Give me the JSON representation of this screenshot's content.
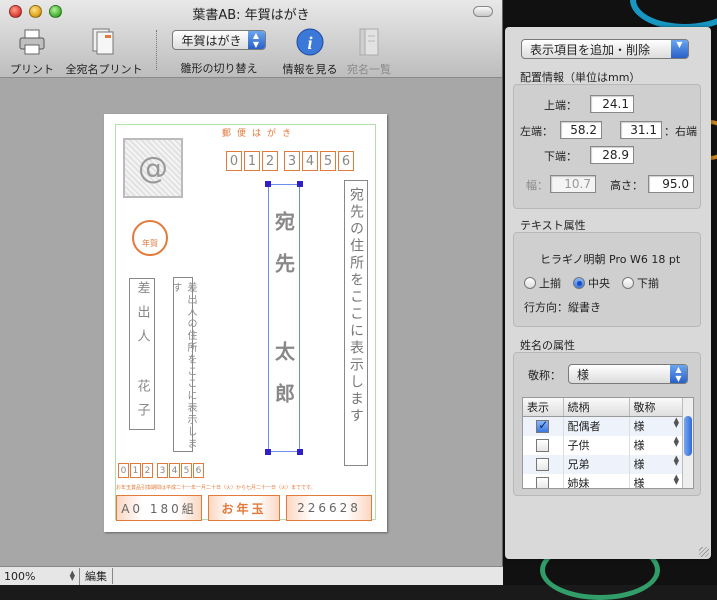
{
  "window": {
    "title": "葉書AB: 年賀はがき"
  },
  "toolbar": {
    "print_label": "プリント",
    "print_all_label": "全宛名プリント",
    "card_type_value": "年賀はがき",
    "card_type_label": "雛形の切り替え",
    "info_label": "情報を見る",
    "address_list_label": "宛名一覧"
  },
  "card": {
    "header_text": "郵便はがき",
    "stamp_symbol": "@",
    "zip_top": [
      "0",
      "1",
      "2",
      "3",
      "4",
      "5",
      "6"
    ],
    "nenga_text": "年賀",
    "recipient_address_placeholder": "宛先の住所をここに表示します",
    "recipient_name": "宛先 太郎",
    "sender_name": "差出人 花子",
    "sender_address_placeholder": "差出人の住所をここに表示します",
    "zip_bottom": [
      "0",
      "1",
      "2",
      "3",
      "4",
      "5",
      "6"
    ],
    "lottery_fine_print": "お年玉賞品引換期間は平成二十一年一月二十日（火）から七月二十一日（火）までです。",
    "lottery_group": "A0 180組",
    "lottery_center": "お年玉",
    "lottery_number": "226628"
  },
  "status": {
    "zoom": "100%",
    "mode": "編集"
  },
  "inspector": {
    "add_remove_popup": "表示項目を追加・削除",
    "layout_section": "配置情報（単位はmm）",
    "top_label": "上端：",
    "top_value": "24.1",
    "left_label": "左端：",
    "left_value": "58.2",
    "right_value": "31.1",
    "right_label": "：右端",
    "bottom_label": "下端：",
    "bottom_value": "28.9",
    "width_label": "幅：",
    "width_value": "10.7",
    "height_label": "高さ：",
    "height_value": "95.0",
    "text_section": "テキスト属性",
    "font_desc": "ヒラギノ明朝 Pro W6 18 pt",
    "align_top": "上揃",
    "align_center": "中央",
    "align_bottom": "下揃",
    "direction": "行方向：縦書き",
    "name_section": "姓名の属性",
    "honorific_label": "敬称：",
    "honorific_value": "様",
    "table_headers": [
      "表示",
      "続柄",
      "敬称"
    ],
    "rows": [
      {
        "relation": "配偶者",
        "honorific": "様",
        "checked": true
      },
      {
        "relation": "子供",
        "honorific": "様",
        "checked": false
      },
      {
        "relation": "兄弟",
        "honorific": "様",
        "checked": false
      },
      {
        "relation": "姉妹",
        "honorific": "様",
        "checked": false
      }
    ]
  }
}
